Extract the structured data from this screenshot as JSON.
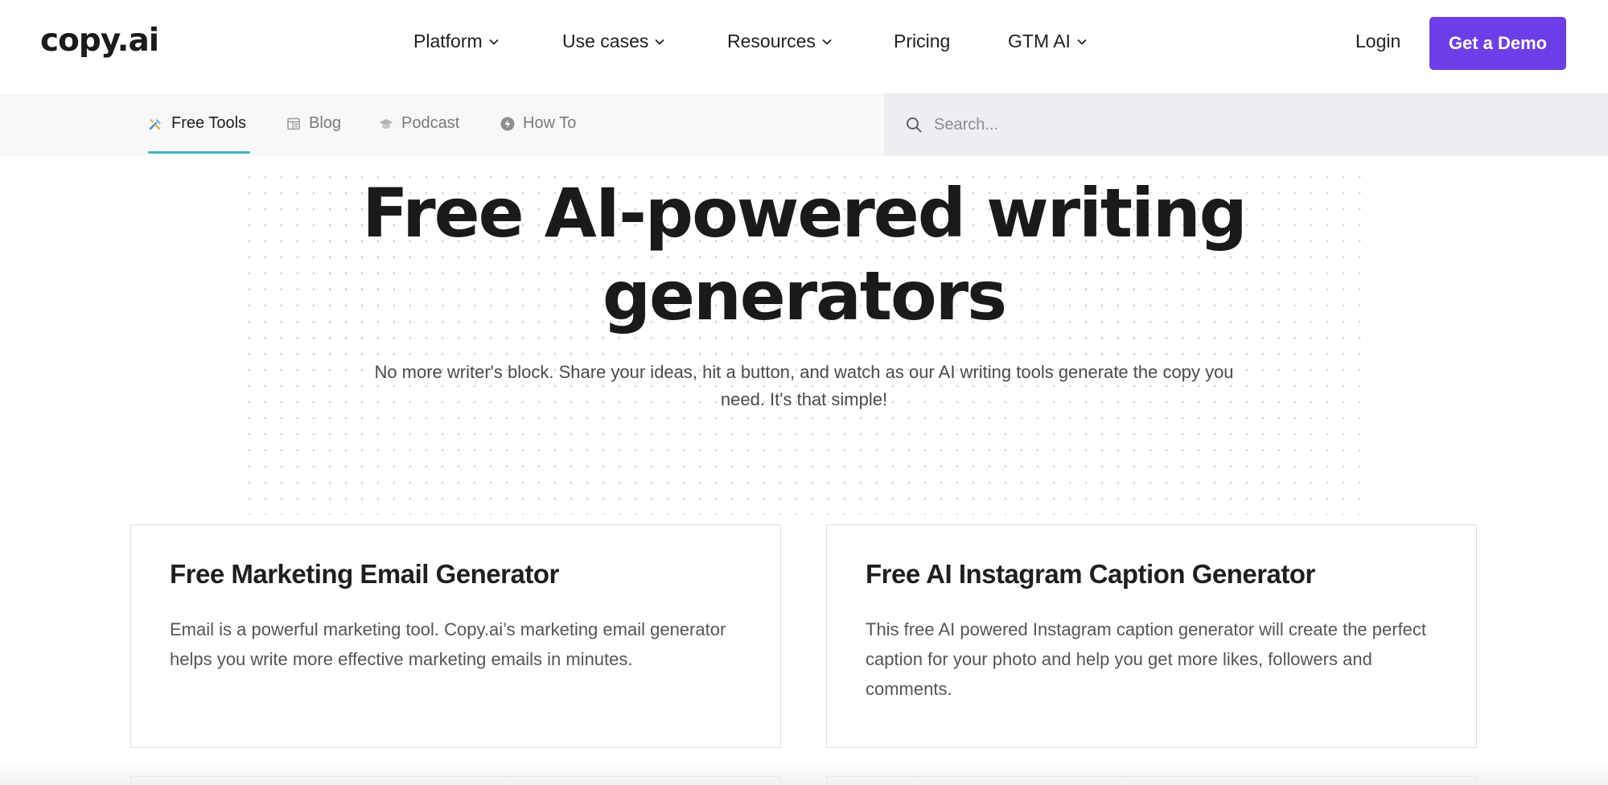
{
  "header": {
    "logo": "copy.ai",
    "nav": [
      {
        "label": "Platform",
        "has_dropdown": true
      },
      {
        "label": "Use cases",
        "has_dropdown": true
      },
      {
        "label": "Resources",
        "has_dropdown": true
      },
      {
        "label": "Pricing",
        "has_dropdown": false
      },
      {
        "label": "GTM AI",
        "has_dropdown": true
      }
    ],
    "login": "Login",
    "demo_button": "Get a Demo",
    "accent_color": "#6d3ee8"
  },
  "subnav": {
    "tabs": [
      {
        "label": "Free Tools",
        "icon": "tools-icon",
        "active": true
      },
      {
        "label": "Blog",
        "icon": "blog-icon",
        "active": false
      },
      {
        "label": "Podcast",
        "icon": "podcast-icon",
        "active": false
      },
      {
        "label": "How To",
        "icon": "how-to-icon",
        "active": false
      }
    ],
    "search_placeholder": "Search...",
    "active_underline_color": "#3fb4c0"
  },
  "hero": {
    "title_line1": "Free AI-powered writing",
    "title_line2": "generators",
    "subtitle_line1": "No more writer's block. Share your ideas, hit a button, and watch as our AI writing tools generate the copy you",
    "subtitle_line2": "need. It's that simple!"
  },
  "cards": [
    {
      "title": "Free Marketing Email Generator",
      "description": "Email is a powerful marketing tool. Copy.ai’s marketing email generator helps you write more effective marketing emails in minutes."
    },
    {
      "title": "Free AI Instagram Caption Generator",
      "description": "This free AI powered Instagram caption generator will create the perfect caption for your photo and help you get more likes, followers and comments."
    }
  ]
}
